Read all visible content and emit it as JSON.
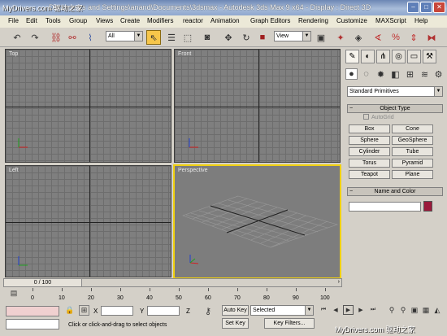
{
  "titlebar": {
    "title": "Documents and Settings\\anand\\Documents\\3dsmax    - Autodesk 3ds Max 9 x64    - Display : Direct 3D",
    "watermark": "MyDrivers.com 驱动之家"
  },
  "menubar": {
    "items": [
      "File",
      "Edit",
      "Tools",
      "Group",
      "Views",
      "Create",
      "Modifiers",
      "reactor",
      "Animation",
      "Graph Editors",
      "Rendering",
      "Customize",
      "MAXScript",
      "Help"
    ]
  },
  "toolbar": {
    "selection_filter": "All",
    "reference_coord": "View",
    "icons": [
      "undo-icon",
      "redo-icon",
      "select-and-link-icon",
      "unlink-icon",
      "bind-space-warp-icon",
      "selection-filter-dropdown",
      "select-object-icon",
      "select-by-name-icon",
      "rectangular-region-icon",
      "window-crossing-icon",
      "select-and-move-icon",
      "select-and-rotate-icon",
      "select-and-scale-icon",
      "reference-coordinate-dropdown",
      "use-pivot-center-icon",
      "select-and-manipulate-icon",
      "snaps-toggle-icon",
      "angle-snap-icon",
      "percent-snap-icon",
      "spinner-snap-icon",
      "named-selection-icon",
      "mirror-icon",
      "align-icon",
      "layer-manager-icon",
      "curve-editor-icon",
      "schematic-view-icon",
      "material-editor-icon",
      "render-scene-icon",
      "quick-render-icon"
    ]
  },
  "viewports": {
    "top": "Top",
    "front": "Front",
    "left": "Left",
    "perspective": "Perspective"
  },
  "command_panel": {
    "tabs": [
      "create-tab-icon",
      "modify-tab-icon",
      "hierarchy-tab-icon",
      "motion-tab-icon",
      "display-tab-icon",
      "utilities-tab-icon"
    ],
    "categories": [
      "geometry-icon",
      "shapes-icon",
      "lights-icon",
      "cameras-icon",
      "helpers-icon",
      "space-warps-icon",
      "systems-icon"
    ],
    "primitive_type": "Standard Primitives",
    "object_type_title": "Object Type",
    "autogrid": "AutoGrid",
    "buttons": [
      "Box",
      "Cone",
      "Sphere",
      "GeoSphere",
      "Cylinder",
      "Tube",
      "Torus",
      "Pyramid",
      "Teapot",
      "Plane"
    ],
    "name_color_title": "Name and Color",
    "object_color": "#9b1a3b"
  },
  "timeslider": {
    "frame": "0 / 100",
    "ticks": [
      "0",
      "10",
      "20",
      "30",
      "40",
      "50",
      "60",
      "70",
      "80",
      "90",
      "100"
    ]
  },
  "status": {
    "x_label": "X",
    "y_label": "Y",
    "z_label": "Z",
    "x_value": "",
    "y_value": "",
    "z_value": "",
    "prompt": "Click or click-and-drag to select objects",
    "auto_key": "Auto Key",
    "set_key": "Set Key",
    "key_mode": "Selected",
    "key_filters": "Key Filters..."
  }
}
